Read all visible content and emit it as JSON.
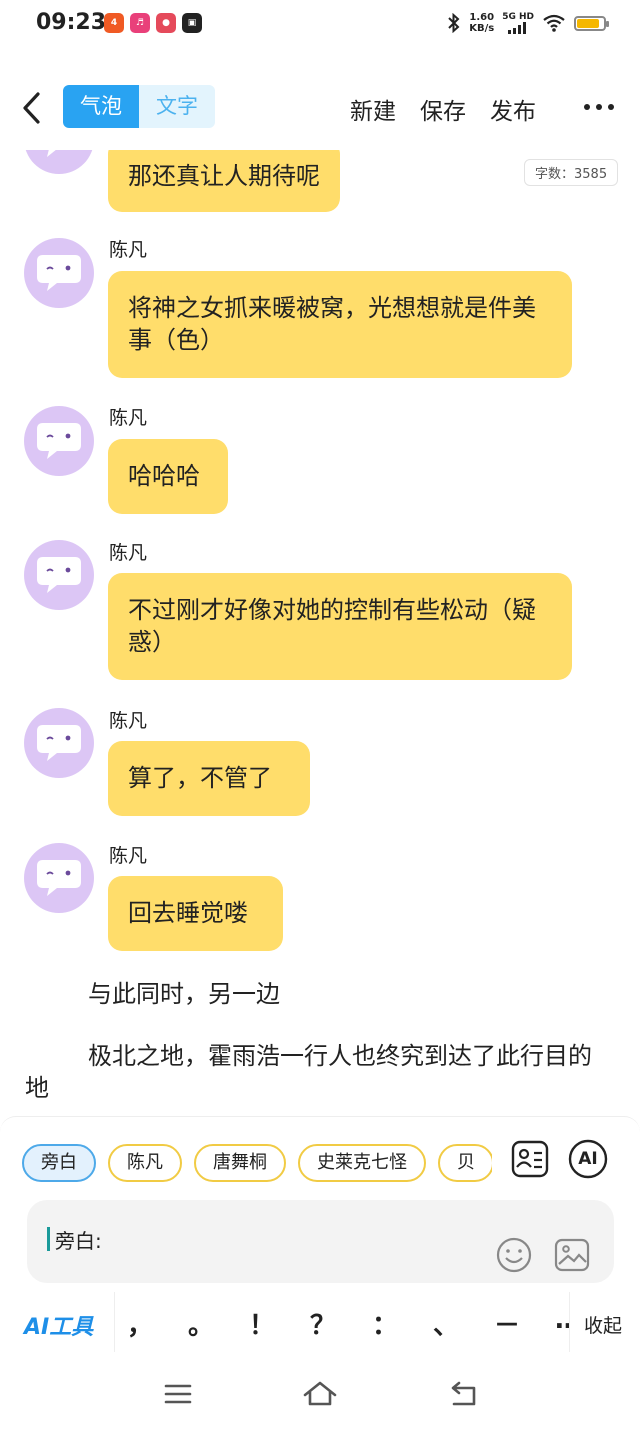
{
  "status_bar": {
    "time": "09:23",
    "net_speed_value": "1.60",
    "net_speed_unit": "KB/s",
    "network_type": "5G HD",
    "app_icons": [
      "app-icon-a",
      "app-icon-b",
      "app-icon-c",
      "app-icon-d"
    ],
    "battery_level": 0.85
  },
  "top_nav": {
    "mode_tabs": [
      {
        "label": "气泡",
        "active": true
      },
      {
        "label": "文字",
        "active": false
      }
    ],
    "actions": [
      "新建",
      "保存",
      "发布"
    ]
  },
  "word_count": "字数：3585",
  "messages": [
    {
      "speaker": "",
      "text": "那还真让人期待呢"
    },
    {
      "speaker": "陈凡",
      "text": "将神之女抓来暖被窝，光想想就是件美事（色）"
    },
    {
      "speaker": "陈凡",
      "text": "哈哈哈"
    },
    {
      "speaker": "陈凡",
      "text": "不过刚才好像对她的控制有些松动（疑惑）"
    },
    {
      "speaker": "陈凡",
      "text": "算了，不管了"
    },
    {
      "speaker": "陈凡",
      "text": "回去睡觉喽"
    }
  ],
  "narration": [
    "与此同时，另一边",
    "极北之地，霍雨浩一行人也终究到达了此行目的地"
  ],
  "characters": [
    "旁白",
    "陈凡",
    "唐舞桐",
    "史莱克七怪",
    "贝"
  ],
  "selected_character": "旁白",
  "input": {
    "value": "旁白:"
  },
  "toolbar": {
    "ai_tools_label": "AI工具",
    "ai_chip_label": "AI",
    "punctuation": [
      "，",
      "。",
      "！",
      "？",
      "：",
      "、",
      "－",
      "…"
    ],
    "collapse_label": "收起"
  },
  "colors": {
    "accent_blue": "#29a3f2",
    "bubble_yellow": "#ffdd6b",
    "avatar_purple": "#dcc6f5",
    "chip_yellow_border": "#f1cb44"
  }
}
